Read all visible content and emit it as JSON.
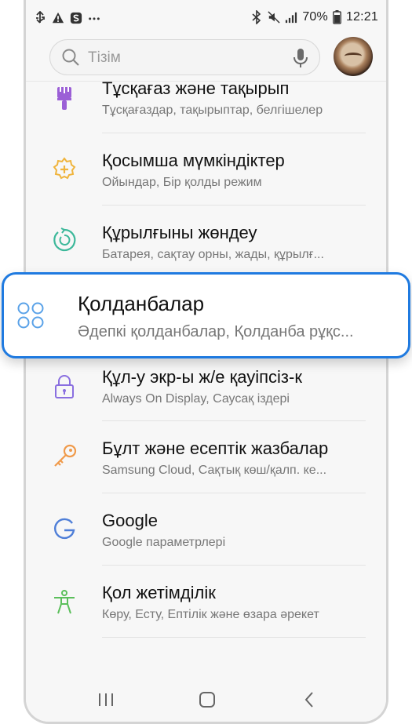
{
  "status_bar": {
    "left_icons": [
      "usb-icon",
      "warning-icon",
      "samsung-s-icon",
      "more-icon"
    ],
    "right_icons": [
      "bluetooth-icon",
      "mute-icon",
      "signal-icon"
    ],
    "battery_percent": "70%",
    "battery_icon": "battery-icon",
    "time": "12:21"
  },
  "search": {
    "placeholder": "Тізім",
    "icon": "search-icon",
    "mic_icon": "mic-icon"
  },
  "settings_items": [
    {
      "title": "Тұсқағаз және тақырып",
      "subtitle": "Тұсқағаздар, тақырыптар, белгішелер",
      "icon": "brush-icon",
      "color": "#9b5fd6"
    },
    {
      "title": "Қосымша мүмкіндіктер",
      "subtitle": "Ойындар, Бір қолды режим",
      "icon": "gear-plus-icon",
      "color": "#f0b43c"
    },
    {
      "title": "Құрылғыны жөндеу",
      "subtitle": "Батарея, сақтау орны, жады, құрылғ...",
      "icon": "device-care-icon",
      "color": "#3cb89a"
    },
    {
      "title": "Құл-у экр-ы ж/е қауіпсіз-к",
      "subtitle": "Always On Display, Саусақ іздері",
      "icon": "lock-icon",
      "color": "#8a6fe0"
    },
    {
      "title": "Бұлт және есептік жазбалар",
      "subtitle": "Samsung Cloud, Сақтық көш/қалп. ке...",
      "icon": "key-icon",
      "color": "#f09a4a"
    },
    {
      "title": "Google",
      "subtitle": "Google параметрлері",
      "icon": "google-g-icon",
      "color": "#4f7fd8"
    },
    {
      "title": "Қол жетімділік",
      "subtitle": "Көру, Есту, Ептілік және өзара әрекет",
      "icon": "accessibility-icon",
      "color": "#5bbf5b"
    }
  ],
  "highlight": {
    "title": "Қолданбалар",
    "subtitle": "Әдепкі қолданбалар, Қолданба рұқс...",
    "icon": "apps-icon",
    "accent": "#1f7ae0",
    "icon_color": "#5aa2e8"
  },
  "nav": {
    "buttons": [
      "recents-icon",
      "home-icon",
      "back-icon"
    ]
  }
}
